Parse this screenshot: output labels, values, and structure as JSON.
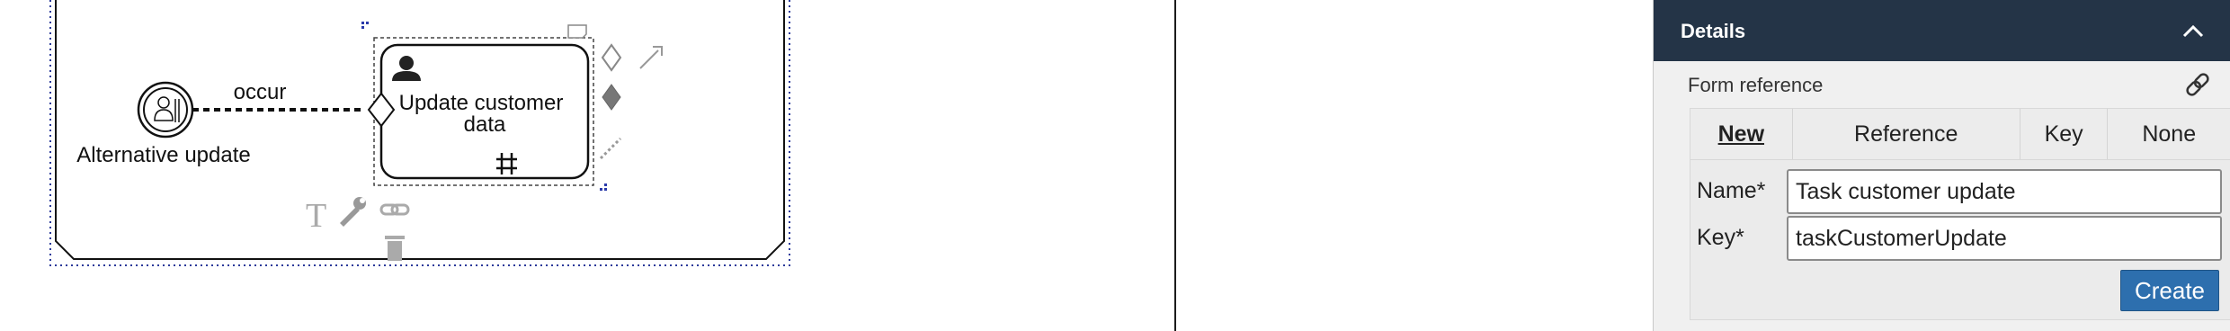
{
  "diagram": {
    "start_event_label": "Alternative update",
    "flow_label": "occur",
    "task_label_line1": "Update customer",
    "task_label_line2": "data"
  },
  "details_panel": {
    "title": "Details",
    "form_reference_label": "Form reference",
    "tabs": [
      {
        "label": "New",
        "active": true
      },
      {
        "label": "Reference",
        "active": false
      },
      {
        "label": "Key",
        "active": false
      },
      {
        "label": "None",
        "active": false
      }
    ],
    "fields": {
      "name": {
        "label": "Name*",
        "value": "Task customer update"
      },
      "key": {
        "label": "Key*",
        "value": "taskCustomerUpdate"
      }
    },
    "create_button_label": "Create"
  },
  "colors": {
    "panel_header_bg": "#243447",
    "create_button_bg": "#2d6fae",
    "selection_dots": "#2233aa"
  }
}
